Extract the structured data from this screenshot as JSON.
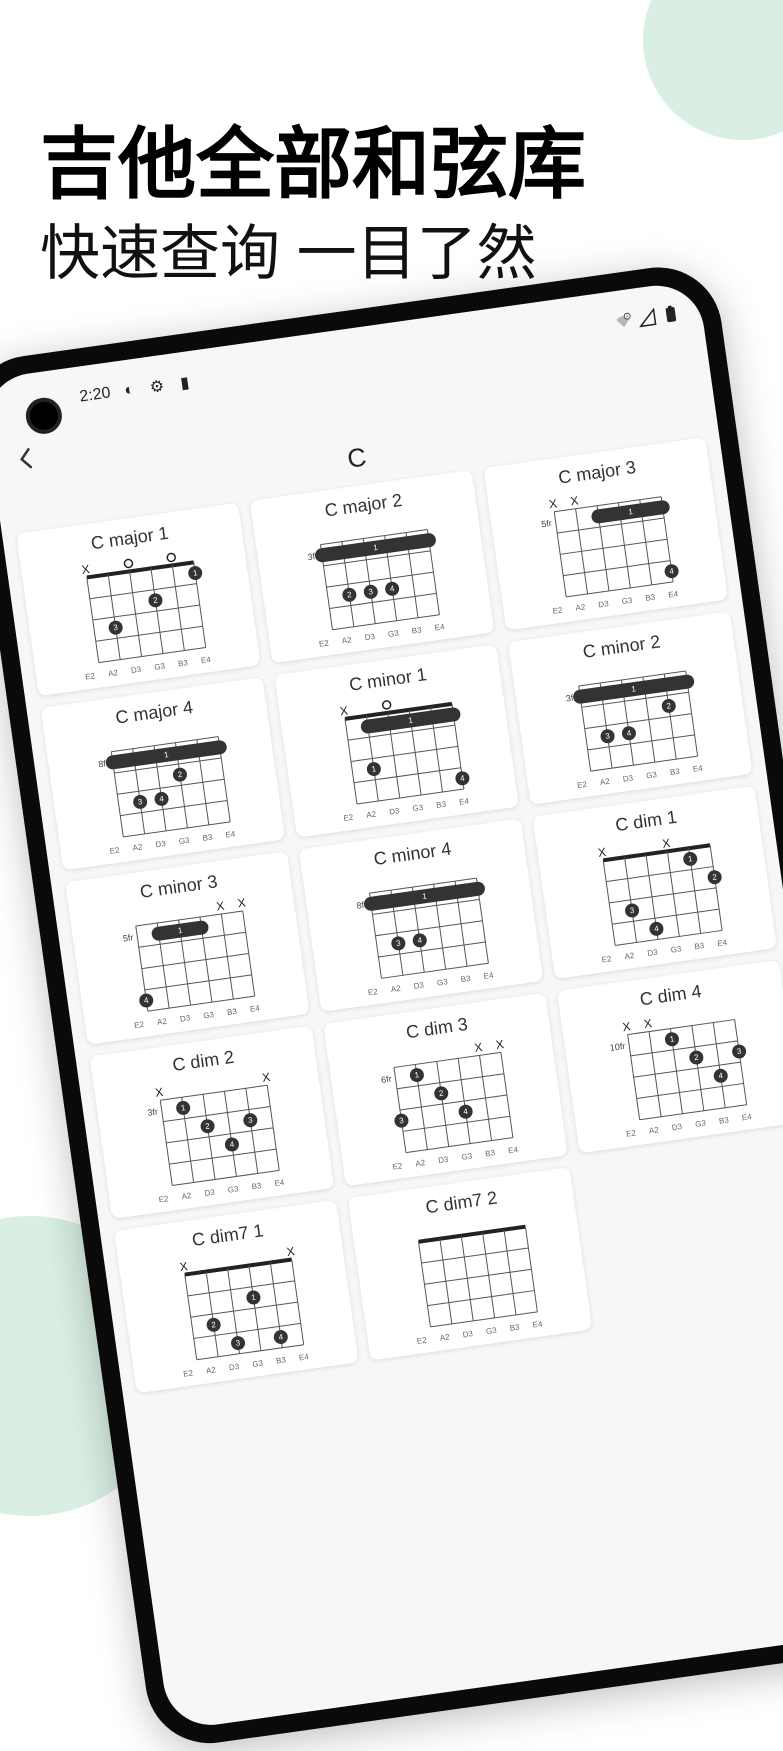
{
  "marketing": {
    "title": "吉他全部和弦库",
    "subtitle": "快速查询 一目了然"
  },
  "status_bar": {
    "time": "2:20",
    "icons": [
      "contrast-icon",
      "gear-icon",
      "sd-card-icon"
    ],
    "right_icons": [
      "wifi-error-icon",
      "signal-icon",
      "battery-icon"
    ]
  },
  "page": {
    "title": "C"
  },
  "string_labels": [
    "E2",
    "A2",
    "D3",
    "G3",
    "B3",
    "E4"
  ],
  "chords": [
    {
      "name": "C major 1",
      "fret_label": "",
      "mutes": [
        0
      ],
      "opens": [
        2,
        4
      ],
      "barre": null,
      "dots": [
        {
          "s": 1,
          "f": 3,
          "n": "3"
        },
        {
          "s": 3,
          "f": 2,
          "n": "2"
        },
        {
          "s": 5,
          "f": 1,
          "n": "1"
        }
      ]
    },
    {
      "name": "C major 2",
      "fret_label": "3fr",
      "mutes": [],
      "opens": [],
      "barre": {
        "from": 0,
        "to": 5,
        "f": 1,
        "n": "1"
      },
      "dots": [
        {
          "s": 1,
          "f": 3,
          "n": "2"
        },
        {
          "s": 2,
          "f": 3,
          "n": "3"
        },
        {
          "s": 3,
          "f": 3,
          "n": "4"
        }
      ]
    },
    {
      "name": "C major 3",
      "fret_label": "5fr",
      "mutes": [
        0,
        1
      ],
      "opens": [],
      "barre": {
        "from": 2,
        "to": 5,
        "f": 1,
        "n": "1"
      },
      "dots": [
        {
          "s": 5,
          "f": 4,
          "n": "4"
        }
      ]
    },
    {
      "name": "C major 4",
      "fret_label": "8fr",
      "mutes": [],
      "opens": [],
      "barre": {
        "from": 0,
        "to": 5,
        "f": 1,
        "n": "1"
      },
      "dots": [
        {
          "s": 1,
          "f": 3,
          "n": "3"
        },
        {
          "s": 2,
          "f": 3,
          "n": "4"
        },
        {
          "s": 3,
          "f": 2,
          "n": "2"
        }
      ]
    },
    {
      "name": "C minor 1",
      "fret_label": "",
      "mutes": [
        0
      ],
      "opens": [
        2
      ],
      "barre": {
        "from": 1,
        "to": 5,
        "f": 1,
        "n": "1"
      },
      "dots": [
        {
          "s": 1,
          "f": 3,
          "n": "1"
        },
        {
          "s": 5,
          "f": 4,
          "n": "4"
        }
      ]
    },
    {
      "name": "C minor 2",
      "fret_label": "3fr",
      "mutes": [],
      "opens": [],
      "barre": {
        "from": 0,
        "to": 5,
        "f": 1,
        "n": "1"
      },
      "dots": [
        {
          "s": 1,
          "f": 3,
          "n": "3"
        },
        {
          "s": 2,
          "f": 3,
          "n": "4"
        },
        {
          "s": 4,
          "f": 2,
          "n": "2"
        }
      ]
    },
    {
      "name": "C minor 3",
      "fret_label": "5fr",
      "mutes": [
        4,
        5
      ],
      "opens": [],
      "barre": {
        "from": 1,
        "to": 3,
        "f": 1,
        "n": "1"
      },
      "dots": [
        {
          "s": 0,
          "f": 4,
          "n": "4"
        }
      ]
    },
    {
      "name": "C minor 4",
      "fret_label": "8fr",
      "mutes": [],
      "opens": [],
      "barre": {
        "from": 0,
        "to": 5,
        "f": 1,
        "n": "1"
      },
      "dots": [
        {
          "s": 1,
          "f": 3,
          "n": "3"
        },
        {
          "s": 2,
          "f": 3,
          "n": "4"
        }
      ]
    },
    {
      "name": "C dim 1",
      "fret_label": "",
      "mutes": [
        0,
        3
      ],
      "opens": [],
      "barre": null,
      "dots": [
        {
          "s": 1,
          "f": 3,
          "n": "3"
        },
        {
          "s": 2,
          "f": 4,
          "n": "4"
        },
        {
          "s": 4,
          "f": 1,
          "n": "1"
        },
        {
          "s": 5,
          "f": 2,
          "n": "2"
        }
      ]
    },
    {
      "name": "C dim 2",
      "fret_label": "3fr",
      "mutes": [
        0,
        5
      ],
      "opens": [],
      "barre": null,
      "dots": [
        {
          "s": 1,
          "f": 1,
          "n": "1"
        },
        {
          "s": 2,
          "f": 2,
          "n": "2"
        },
        {
          "s": 3,
          "f": 3,
          "n": "4"
        },
        {
          "s": 4,
          "f": 2,
          "n": "3"
        }
      ]
    },
    {
      "name": "C dim 3",
      "fret_label": "6fr",
      "mutes": [
        4,
        5
      ],
      "opens": [],
      "barre": null,
      "dots": [
        {
          "s": 0,
          "f": 3,
          "n": "3"
        },
        {
          "s": 1,
          "f": 1,
          "n": "1"
        },
        {
          "s": 2,
          "f": 2,
          "n": "2"
        },
        {
          "s": 3,
          "f": 3,
          "n": "4"
        }
      ]
    },
    {
      "name": "C dim 4",
      "fret_label": "10fr",
      "mutes": [
        0,
        1
      ],
      "opens": [],
      "barre": null,
      "dots": [
        {
          "s": 2,
          "f": 1,
          "n": "1"
        },
        {
          "s": 3,
          "f": 2,
          "n": "2"
        },
        {
          "s": 4,
          "f": 3,
          "n": "4"
        },
        {
          "s": 5,
          "f": 2,
          "n": "3"
        }
      ]
    },
    {
      "name": "C dim7 1",
      "fret_label": "",
      "mutes": [
        0,
        5
      ],
      "opens": [],
      "barre": null,
      "dots": [
        {
          "s": 1,
          "f": 3,
          "n": "2"
        },
        {
          "s": 2,
          "f": 4,
          "n": "3"
        },
        {
          "s": 3,
          "f": 2,
          "n": "1"
        },
        {
          "s": 4,
          "f": 4,
          "n": "4"
        }
      ]
    },
    {
      "name": "C dim7 2",
      "fret_label": "",
      "mutes": [],
      "opens": [],
      "barre": null,
      "dots": []
    }
  ]
}
